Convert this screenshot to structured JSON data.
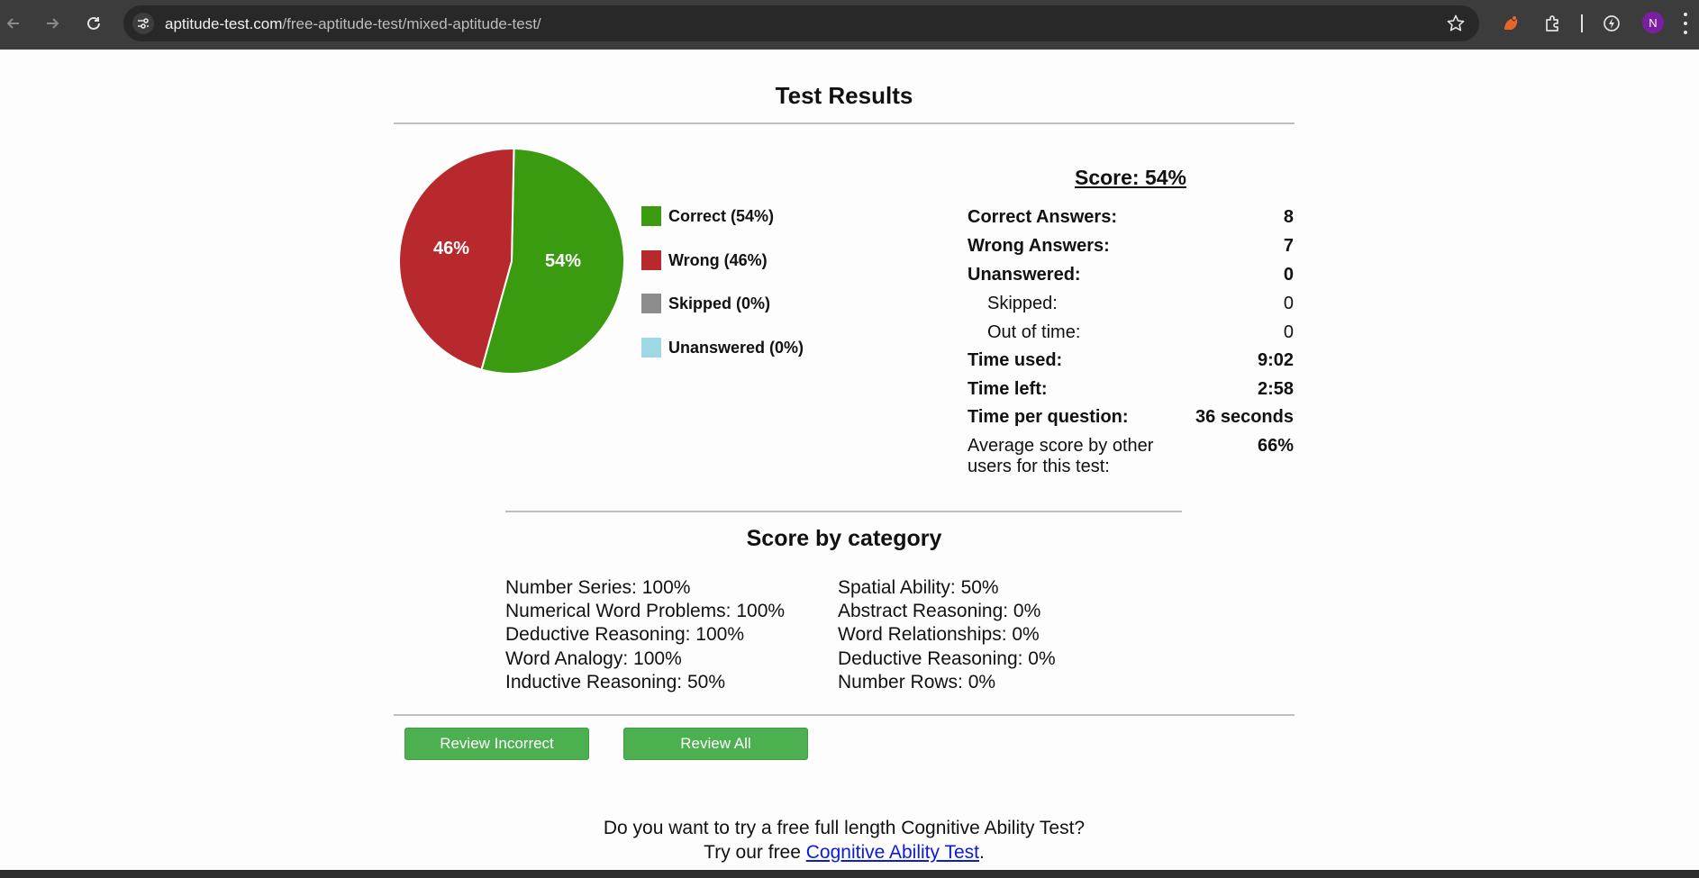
{
  "browser": {
    "url_host": "aptitude-test.com",
    "url_path": "/free-aptitude-test/mixed-aptitude-test/",
    "avatar_initial": "N",
    "icons": [
      "back-icon",
      "forward-icon",
      "reload-icon",
      "site-info-icon",
      "bookmark-star-icon",
      "extension-orange-icon",
      "extensions-puzzle-icon",
      "extension-lightning-icon",
      "menu-kebab-icon"
    ]
  },
  "page": {
    "title": "Test Results"
  },
  "chart_data": {
    "type": "pie",
    "slices": [
      {
        "label": "Correct (54%)",
        "value": 54,
        "color": "#3a9a10"
      },
      {
        "label": "Wrong (46%)",
        "value": 46,
        "color": "#b8292d"
      },
      {
        "label": "Skipped (0%)",
        "value": 0,
        "color": "#8c8c8c"
      },
      {
        "label": "Unanswered (0%)",
        "value": 0,
        "color": "#9ed8e4"
      }
    ],
    "data_labels": [
      "54%",
      "46%"
    ]
  },
  "score": {
    "title": "Score: 54%",
    "rows": [
      {
        "key": "Correct Answers:",
        "value": "8"
      },
      {
        "key": "Wrong Answers:",
        "value": "7"
      },
      {
        "key": "Unanswered:",
        "value": "0"
      },
      {
        "key": "Skipped:",
        "value": "0"
      },
      {
        "key": "Out of time:",
        "value": "0"
      },
      {
        "key": "Time used:",
        "value": "9:02"
      },
      {
        "key": "Time left:",
        "value": "2:58"
      },
      {
        "key": "Time per question:",
        "value": "36 seconds"
      },
      {
        "key": "Average score by other users for this test:",
        "value": "66%"
      }
    ]
  },
  "categories": {
    "title": "Score by category",
    "left": [
      "Number Series: 100%",
      "Numerical Word Problems: 100%",
      "Deductive Reasoning: 100%",
      "Word Analogy: 100%",
      "Inductive Reasoning: 50%"
    ],
    "right": [
      "Spatial Ability: 50%",
      "Abstract Reasoning: 0%",
      "Word Relationships: 0%",
      "Deductive Reasoning: 0%",
      "Number Rows: 0%"
    ]
  },
  "buttons": {
    "review_incorrect": "Review Incorrect",
    "review_all": "Review All"
  },
  "promo": {
    "line1": "Do you want to try a free full length Cognitive Ability Test?",
    "line2_prefix": "Try our free ",
    "link_text": "Cognitive Ability Test",
    "line2_suffix": "."
  },
  "colors": {
    "accent_button": "#4caf50",
    "link": "#0b1bdb"
  }
}
